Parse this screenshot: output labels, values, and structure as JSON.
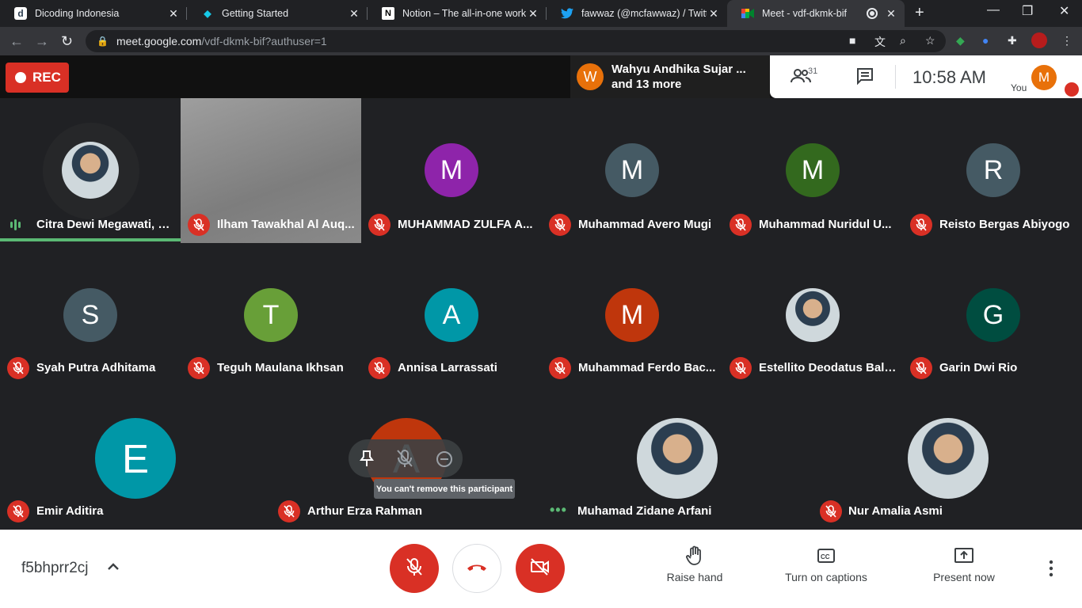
{
  "browser": {
    "tabs": [
      {
        "title": "Dicoding Indonesia",
        "favicon": "D",
        "color": "#ffffff"
      },
      {
        "title": "Getting Started",
        "favicon": "◆",
        "color": "#16c8e6"
      },
      {
        "title": "Notion – The all-in-one worksp",
        "favicon": "N",
        "color": "#ffffff"
      },
      {
        "title": "fawwaz (@mcfawwaz) / Twitter",
        "favicon": "🐦",
        "color": "#1da1f2"
      },
      {
        "title": "Meet - vdf-dkmk-bif",
        "favicon": "■",
        "color": "#00ac47"
      }
    ],
    "url_host": "meet.google.com",
    "url_path": "/vdf-dkmk-bif?authuser=1"
  },
  "meet": {
    "rec_label": "REC",
    "speaker_initial": "W",
    "speaker_line1": "Wahyu Andhika Sujar ...",
    "speaker_line2": "and 13 more",
    "participant_count": "31",
    "clock": "10:58  AM",
    "you_label": "You",
    "you_initial": "M"
  },
  "participants": [
    {
      "name": "Citra Dewi Megawati, S....",
      "type": "photo",
      "speaking": true
    },
    {
      "name": "Ilham Tawakhal Al Auq...",
      "type": "video"
    },
    {
      "name": "MUHAMMAD ZULFA A...",
      "initial": "M",
      "color": "#8e24aa"
    },
    {
      "name": "Muhammad Avero Mugi",
      "initial": "M",
      "color": "#455a64"
    },
    {
      "name": "Muhammad Nuridul U...",
      "initial": "M",
      "color": "#33691e"
    },
    {
      "name": "Reisto Bergas Abiyogo",
      "initial": "R",
      "color": "#455a64"
    },
    {
      "name": "Syah Putra Adhitama",
      "initial": "S",
      "color": "#455a64"
    },
    {
      "name": "Teguh Maulana Ikhsan",
      "initial": "T",
      "color": "#689f38"
    },
    {
      "name": "Annisa Larrassati",
      "initial": "A",
      "color": "#0097a7"
    },
    {
      "name": "Muhammad Ferdo Bac...",
      "initial": "M",
      "color": "#bf360c"
    },
    {
      "name": "Estellito Deodatus Bala...",
      "type": "photo"
    },
    {
      "name": "Garin Dwi Rio",
      "initial": "G",
      "color": "#004d40"
    },
    {
      "name": "Emir Aditira",
      "initial": "E",
      "color": "#0097a7"
    },
    {
      "name": "Arthur Erza Rahman",
      "initial": "A",
      "color": "#bf360c"
    },
    {
      "name": "Muhamad Zidane Arfani",
      "type": "photo"
    },
    {
      "name": "Nur Amalia Asmi",
      "type": "photo"
    }
  ],
  "tooltip": "You can't remove this participant",
  "bottom": {
    "meeting_code": "f5bhprr2cj",
    "raise_hand": "Raise hand",
    "captions": "Turn on captions",
    "present": "Present now"
  }
}
